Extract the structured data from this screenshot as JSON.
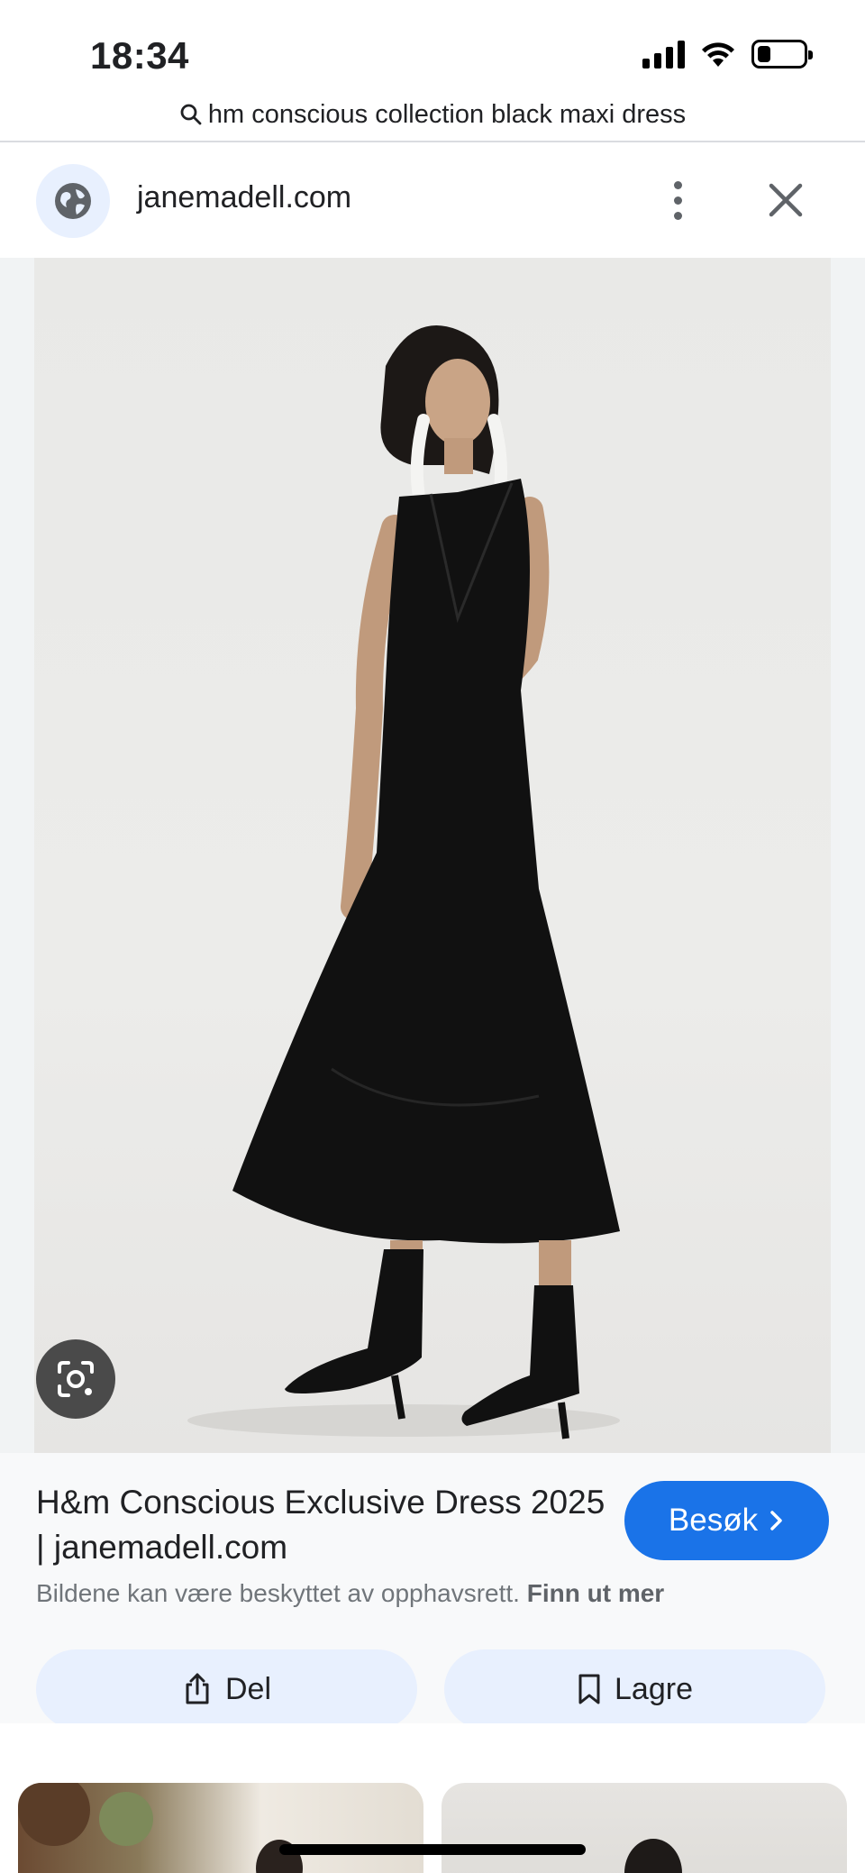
{
  "status_bar": {
    "time": "18:34",
    "battery_level": 0.3
  },
  "query": {
    "text": "hm conscious collection black maxi dress",
    "icon": "search-icon"
  },
  "site": {
    "name": "janemadell.com",
    "favicon": "globe-icon"
  },
  "result": {
    "title": "H&m Conscious Exclusive Dress 2025 | janemadell.com",
    "visit_label": "Besøk",
    "copyright_text": "Bildene kan være beskyttet av opphavsrett.",
    "learn_more": "Finn ut mer"
  },
  "actions": {
    "share_label": "Del",
    "save_label": "Lagre"
  },
  "colors": {
    "accent": "#1a73e8",
    "chip_bg": "#e8f0fe",
    "panel_bg": "#f8f9fa"
  }
}
